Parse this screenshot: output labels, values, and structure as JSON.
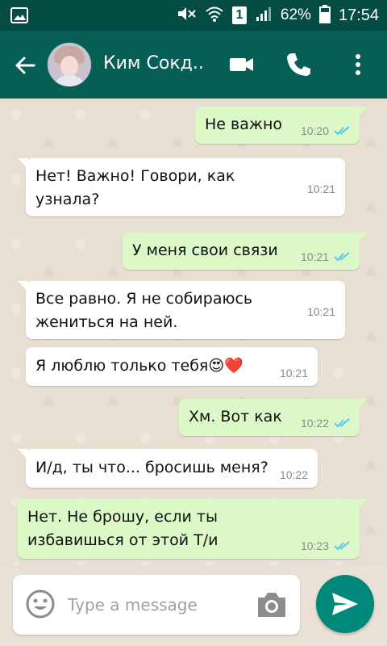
{
  "status_bar": {
    "battery_percent": "62%",
    "time": "17:54",
    "sim_slot": "1"
  },
  "header": {
    "contact_name": "Ким Сокд..",
    "icons": [
      "back-arrow-icon",
      "video-call-icon",
      "phone-icon",
      "more-vert-icon"
    ]
  },
  "messages": [
    {
      "dir": "out",
      "text": "Не важно",
      "time": "10:20",
      "read": true
    },
    {
      "dir": "in",
      "lines": [
        "Нет! Важно! Говори, как",
        "узнала?"
      ],
      "time": "10:21"
    },
    {
      "dir": "out",
      "text": "У меня свои связи",
      "time": "10:21",
      "read": true
    },
    {
      "dir": "in",
      "lines": [
        "Все равно. Я не собираюсь",
        "жениться на ней."
      ],
      "time": "10:21"
    },
    {
      "dir": "in",
      "text": "Я люблю только тебя😍❤️",
      "time": "10:21"
    },
    {
      "dir": "out",
      "text": "Хм. Вот как",
      "time": "10:22",
      "read": true
    },
    {
      "dir": "in",
      "text": "И/д, ты что... бросишь меня?",
      "time": "10:22"
    },
    {
      "dir": "out",
      "lines": [
        "Нет. Не брошу, если ты",
        "избавишься от этой Т/и"
      ],
      "time": "10:23",
      "read": true
    }
  ],
  "input": {
    "placeholder": "Type a message"
  },
  "colors": {
    "status_bar": "#054d44",
    "header": "#075e54",
    "outgoing_bubble": "#dcf8c6",
    "incoming_bubble": "#ffffff",
    "read_ticks": "#4fc3f7",
    "send_button": "#00897b"
  }
}
